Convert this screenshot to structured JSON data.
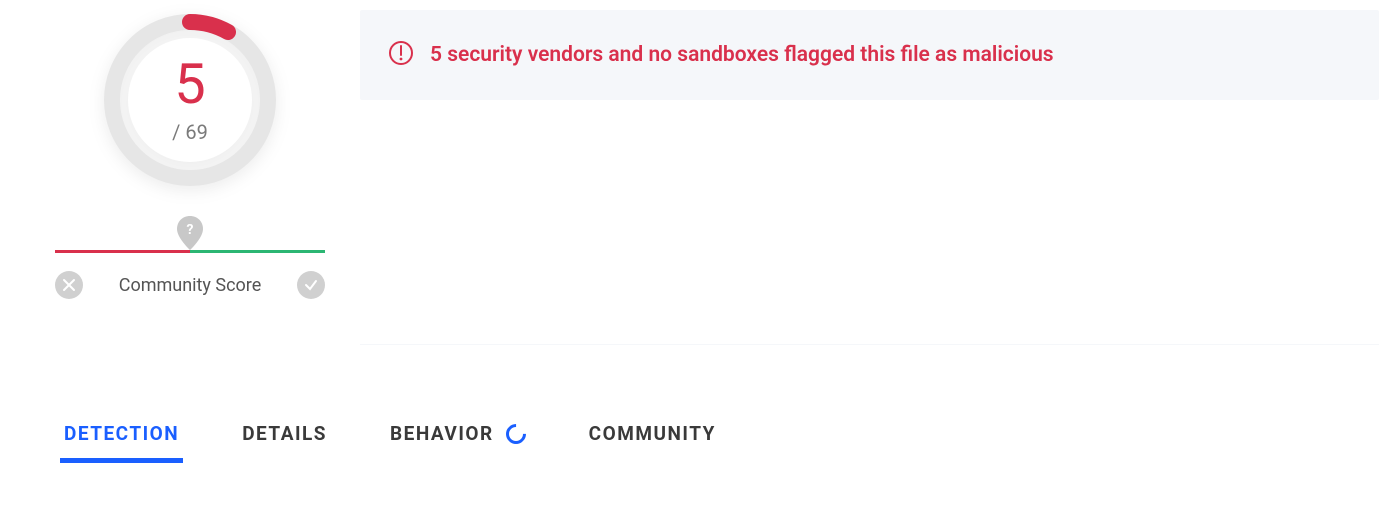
{
  "score": {
    "detections": "5",
    "total_prefix": "/ ",
    "total": "69"
  },
  "community": {
    "label": "Community Score"
  },
  "alert": {
    "message": "5 security vendors and no sandboxes flagged this file as malicious"
  },
  "tabs": {
    "detection": "DETECTION",
    "details": "DETAILS",
    "behavior": "BEHAVIOR",
    "community": "COMMUNITY"
  },
  "colors": {
    "danger": "#d9304c",
    "safe": "#2bb673",
    "accent": "#1a5fff",
    "muted": "#d0d0d0"
  }
}
